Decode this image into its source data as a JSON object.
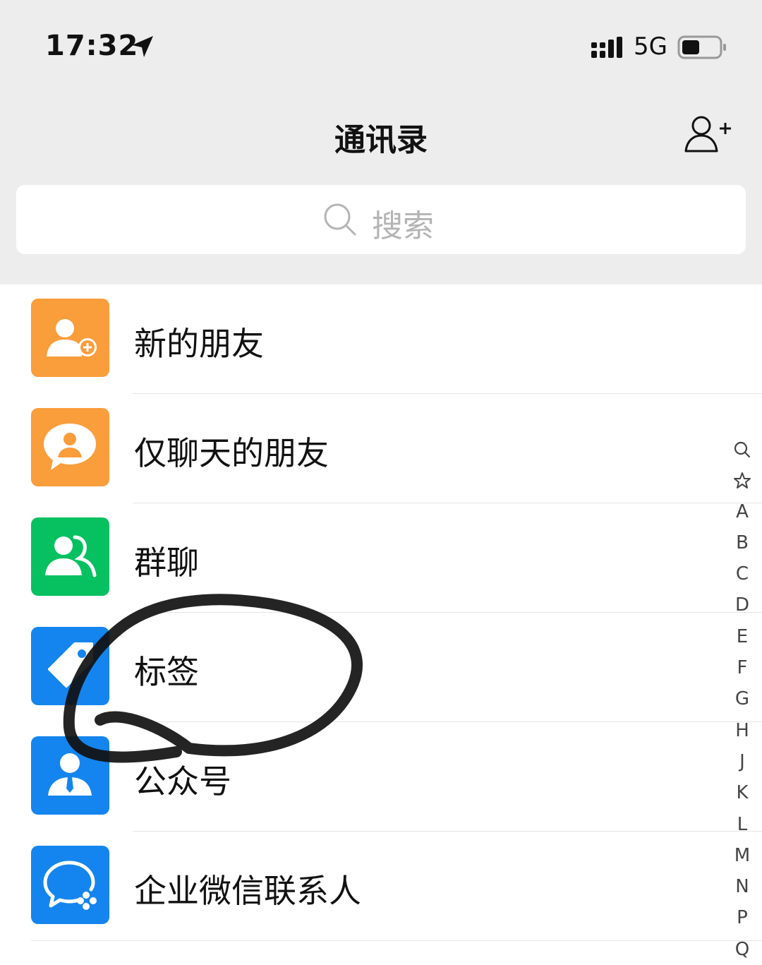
{
  "status_bar": {
    "time": "17:32",
    "network": "5G"
  },
  "header": {
    "title": "通讯录",
    "add_contact_icon": "add-contact-icon"
  },
  "search": {
    "placeholder": "搜索"
  },
  "entries": [
    {
      "label": "新的朋友",
      "icon": "new-friend-icon",
      "color": "#fa9d3b"
    },
    {
      "label": "仅聊天的朋友",
      "icon": "chat-only-friend-icon",
      "color": "#fa9d3b"
    },
    {
      "label": "群聊",
      "icon": "group-chat-icon",
      "color": "#07c160"
    },
    {
      "label": "标签",
      "icon": "tag-icon",
      "color": "#1485ee"
    },
    {
      "label": "公众号",
      "icon": "official-account-icon",
      "color": "#1485ee"
    },
    {
      "label": "企业微信联系人",
      "icon": "wecom-contacts-icon",
      "color": "#1485ee"
    }
  ],
  "index_bar": [
    "search-icon",
    "star-icon",
    "A",
    "B",
    "C",
    "D",
    "E",
    "F",
    "G",
    "H",
    "J",
    "K",
    "L",
    "M",
    "N",
    "P",
    "Q"
  ],
  "annotation": {
    "type": "hand-drawn-circle",
    "color": "#111111"
  }
}
